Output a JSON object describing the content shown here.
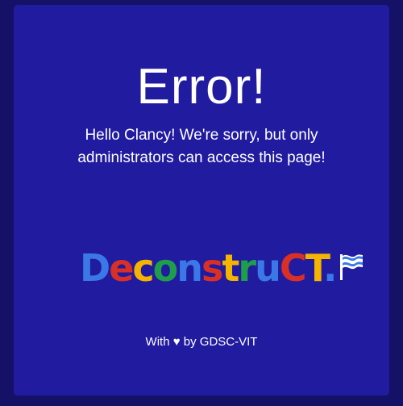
{
  "error": {
    "title": "Error!",
    "message": "Hello Clancy! We're sorry, but only administrators can access this page!"
  },
  "logo": {
    "text": "DeconstruCT.",
    "letters": [
      {
        "char": "D",
        "color": "#3b78e7"
      },
      {
        "char": "e",
        "color": "#d93025"
      },
      {
        "char": "c",
        "color": "#f4b400"
      },
      {
        "char": "o",
        "color": "#1e9e4a"
      },
      {
        "char": "n",
        "color": "#3b78e7"
      },
      {
        "char": "s",
        "color": "#d93025"
      },
      {
        "char": "t",
        "color": "#f4b400"
      },
      {
        "char": "r",
        "color": "#1e9e4a"
      },
      {
        "char": "u",
        "color": "#3b78e7"
      },
      {
        "char": "C",
        "color": "#d93025"
      },
      {
        "char": "T",
        "color": "#f4b400"
      },
      {
        "char": ".",
        "color": "#3b78e7"
      }
    ],
    "flag_icon": "flag-icon"
  },
  "footer": {
    "text": "With ♥ by GDSC-VIT"
  },
  "colors": {
    "page_background": "#141166",
    "card_background": "#211ba0",
    "text": "#ffffff"
  }
}
